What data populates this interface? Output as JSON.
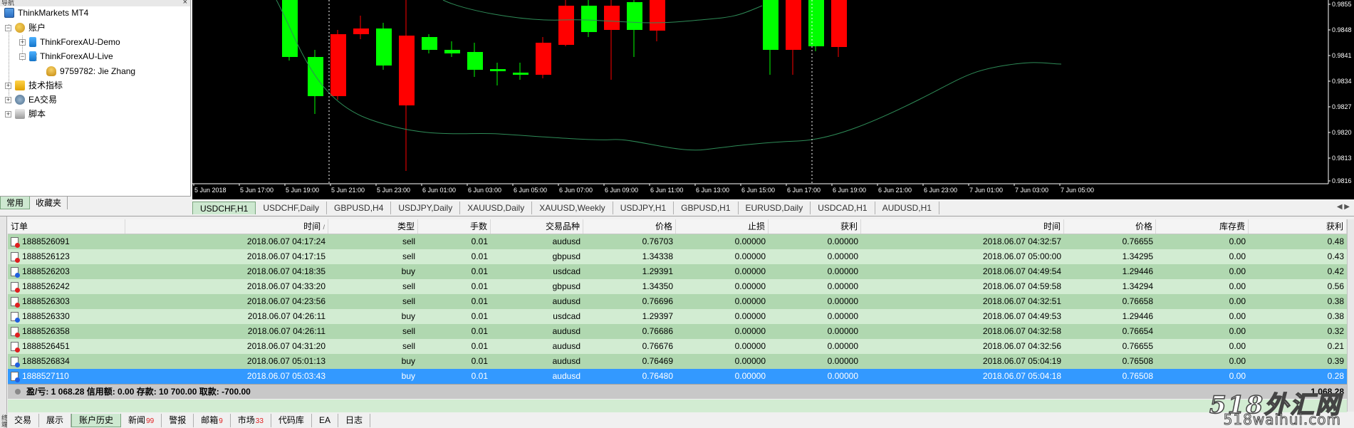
{
  "navigator": {
    "title": "导航",
    "close": "×",
    "items": [
      {
        "label": "ThinkMarkets MT4"
      },
      {
        "label": "账户"
      },
      {
        "label": "ThinkForexAU-Demo"
      },
      {
        "label": "ThinkForexAU-Live"
      },
      {
        "label": "9759782: Jie Zhang"
      },
      {
        "label": "技术指标"
      },
      {
        "label": "EA交易"
      },
      {
        "label": "脚本"
      }
    ],
    "tabs": [
      {
        "label": "常用",
        "active": true
      },
      {
        "label": "收藏夹",
        "active": false
      }
    ]
  },
  "chart": {
    "time_labels": [
      "5 Jun 2018",
      "5 Jun 17:00",
      "5 Jun 19:00",
      "5 Jun 21:00",
      "5 Jun 23:00",
      "6 Jun 01:00",
      "6 Jun 03:00",
      "6 Jun 05:00",
      "6 Jun 07:00",
      "6 Jun 09:00",
      "6 Jun 11:00",
      "6 Jun 13:00",
      "6 Jun 15:00",
      "6 Jun 17:00",
      "6 Jun 19:00",
      "6 Jun 21:00",
      "6 Jun 23:00",
      "7 Jun 01:00",
      "7 Jun 03:00",
      "7 Jun 05:00"
    ],
    "price_labels": [
      "0.9855",
      "0.9848",
      "0.9841",
      "0.9834",
      "0.9827",
      "0.9820",
      "0.9813",
      "0.9816"
    ],
    "colors": {
      "bull": "#00ff00",
      "bear": "#ff0000",
      "ma": "#2e8b57",
      "background": "#000000"
    }
  },
  "chart_tabs": [
    {
      "label": "USDCHF,H1",
      "active": true
    },
    {
      "label": "USDCHF,Daily"
    },
    {
      "label": "GBPUSD,H4"
    },
    {
      "label": "USDJPY,Daily"
    },
    {
      "label": "XAUUSD,Daily"
    },
    {
      "label": "XAUUSD,Weekly"
    },
    {
      "label": "USDJPY,H1"
    },
    {
      "label": "GBPUSD,H1"
    },
    {
      "label": "EURUSD,Daily"
    },
    {
      "label": "USDCAD,H1"
    },
    {
      "label": "AUDUSD,H1"
    }
  ],
  "terminal": {
    "side_label": "终端",
    "headers": {
      "order": "订单",
      "time": "时间",
      "sort": "/",
      "type": "类型",
      "lots": "手数",
      "symbol": "交易品种",
      "price": "价格",
      "sl": "止损",
      "tp": "获利",
      "close_time": "时间",
      "close_price": "价格",
      "swap": "库存费",
      "profit": "获利"
    },
    "rows": [
      {
        "order": "1888526091",
        "time": "2018.06.07 04:17:24",
        "type": "sell",
        "lots": "0.01",
        "symbol": "audusd",
        "price": "0.76703",
        "sl": "0.00000",
        "tp": "0.00000",
        "close_time": "2018.06.07 04:32:57",
        "close_price": "0.76655",
        "swap": "0.00",
        "profit": "0.48"
      },
      {
        "order": "1888526123",
        "time": "2018.06.07 04:17:15",
        "type": "sell",
        "lots": "0.01",
        "symbol": "gbpusd",
        "price": "1.34338",
        "sl": "0.00000",
        "tp": "0.00000",
        "close_time": "2018.06.07 05:00:00",
        "close_price": "1.34295",
        "swap": "0.00",
        "profit": "0.43"
      },
      {
        "order": "1888526203",
        "time": "2018.06.07 04:18:35",
        "type": "buy",
        "lots": "0.01",
        "symbol": "usdcad",
        "price": "1.29391",
        "sl": "0.00000",
        "tp": "0.00000",
        "close_time": "2018.06.07 04:49:54",
        "close_price": "1.29446",
        "swap": "0.00",
        "profit": "0.42"
      },
      {
        "order": "1888526242",
        "time": "2018.06.07 04:33:20",
        "type": "sell",
        "lots": "0.01",
        "symbol": "gbpusd",
        "price": "1.34350",
        "sl": "0.00000",
        "tp": "0.00000",
        "close_time": "2018.06.07 04:59:58",
        "close_price": "1.34294",
        "swap": "0.00",
        "profit": "0.56"
      },
      {
        "order": "1888526303",
        "time": "2018.06.07 04:23:56",
        "type": "sell",
        "lots": "0.01",
        "symbol": "audusd",
        "price": "0.76696",
        "sl": "0.00000",
        "tp": "0.00000",
        "close_time": "2018.06.07 04:32:51",
        "close_price": "0.76658",
        "swap": "0.00",
        "profit": "0.38"
      },
      {
        "order": "1888526330",
        "time": "2018.06.07 04:26:11",
        "type": "buy",
        "lots": "0.01",
        "symbol": "usdcad",
        "price": "1.29397",
        "sl": "0.00000",
        "tp": "0.00000",
        "close_time": "2018.06.07 04:49:53",
        "close_price": "1.29446",
        "swap": "0.00",
        "profit": "0.38"
      },
      {
        "order": "1888526358",
        "time": "2018.06.07 04:26:11",
        "type": "sell",
        "lots": "0.01",
        "symbol": "audusd",
        "price": "0.76686",
        "sl": "0.00000",
        "tp": "0.00000",
        "close_time": "2018.06.07 04:32:58",
        "close_price": "0.76654",
        "swap": "0.00",
        "profit": "0.32"
      },
      {
        "order": "1888526451",
        "time": "2018.06.07 04:31:20",
        "type": "sell",
        "lots": "0.01",
        "symbol": "audusd",
        "price": "0.76676",
        "sl": "0.00000",
        "tp": "0.00000",
        "close_time": "2018.06.07 04:32:56",
        "close_price": "0.76655",
        "swap": "0.00",
        "profit": "0.21"
      },
      {
        "order": "1888526834",
        "time": "2018.06.07 05:01:13",
        "type": "buy",
        "lots": "0.01",
        "symbol": "audusd",
        "price": "0.76469",
        "sl": "0.00000",
        "tp": "0.00000",
        "close_time": "2018.06.07 05:04:19",
        "close_price": "0.76508",
        "swap": "0.00",
        "profit": "0.39"
      },
      {
        "order": "1888527110",
        "time": "2018.06.07 05:03:43",
        "type": "buy",
        "lots": "0.01",
        "symbol": "audusd",
        "price": "0.76480",
        "sl": "0.00000",
        "tp": "0.00000",
        "close_time": "2018.06.07 05:04:18",
        "close_price": "0.76508",
        "swap": "0.00",
        "profit": "0.28",
        "selected": true
      }
    ],
    "summary": {
      "text": "盈/亏: 1 068.28  信用额: 0.00  存款: 10 700.00  取款: -700.00",
      "total": "1 068.28"
    },
    "tabs": [
      {
        "label": "交易"
      },
      {
        "label": "展示"
      },
      {
        "label": "账户历史",
        "active": true
      },
      {
        "label": "新闻",
        "badge": "99"
      },
      {
        "label": "警报"
      },
      {
        "label": "邮箱",
        "badge": "9"
      },
      {
        "label": "市场",
        "badge": "33"
      },
      {
        "label": "代码库"
      },
      {
        "label": "EA"
      },
      {
        "label": "日志"
      }
    ]
  },
  "watermark": {
    "line1": "518外汇网",
    "line2": "518waihui.com"
  }
}
